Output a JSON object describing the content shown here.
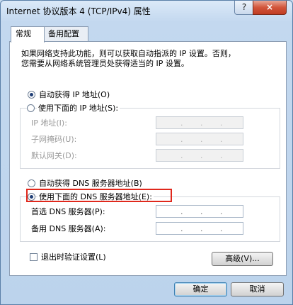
{
  "window": {
    "title": "Internet 协议版本 4 (TCP/IPv4) 属性",
    "help_label": "?",
    "close_label": "×"
  },
  "tabs": [
    {
      "label": "常规"
    },
    {
      "label": "备用配置"
    }
  ],
  "intro_text": {
    "line1": "如果网络支持此功能，则可以获取自动指派的 IP 设置。否则，",
    "line2": "您需要从网络系统管理员处获得适当的 IP 设置。"
  },
  "ip": {
    "auto_label": "自动获得 IP 地址(O)",
    "manual_label": "使用下面的 IP 地址(S):",
    "address_label": "IP 地址(I):",
    "mask_label": "子网掩码(U):",
    "gateway_label": "默认网关(D):"
  },
  "dns": {
    "auto_label": "自动获得 DNS 服务器地址(B)",
    "manual_label": "使用下面的 DNS 服务器地址(E):",
    "preferred_label": "首选 DNS 服务器(P):",
    "alternate_label": "备用 DNS 服务器(A):"
  },
  "validate_label": "退出时验证设置(L)",
  "advanced_label": "高级(V)...",
  "ok_label": "确定",
  "cancel_label": "取消",
  "ip_separator": ".",
  "colors": {
    "highlight_box": "#e0281c"
  }
}
